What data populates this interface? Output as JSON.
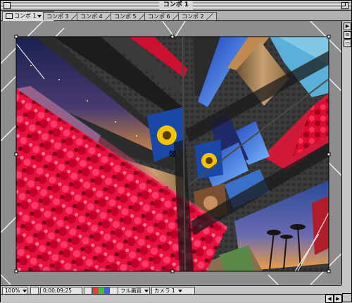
{
  "window": {
    "title": "コンポ 1"
  },
  "tabs": [
    {
      "label": "コンポ 1",
      "active": true
    },
    {
      "label": "コンポ 3",
      "active": false
    },
    {
      "label": "コンポ 4",
      "active": false
    },
    {
      "label": "コンポ 5",
      "active": false
    },
    {
      "label": "コンポ 6",
      "active": false
    },
    {
      "label": "コンポ 2",
      "active": false
    }
  ],
  "statusbar": {
    "zoom": "100%",
    "timecode": "0;00;09;25",
    "quality": "フル画質",
    "camera": "カメラ 1"
  },
  "colors": {
    "window_bg": "#c6c6c6",
    "comp_bg": "#2a2a2a",
    "flower_red": "#e8103c",
    "sky_blue": "#2f6fd8"
  }
}
